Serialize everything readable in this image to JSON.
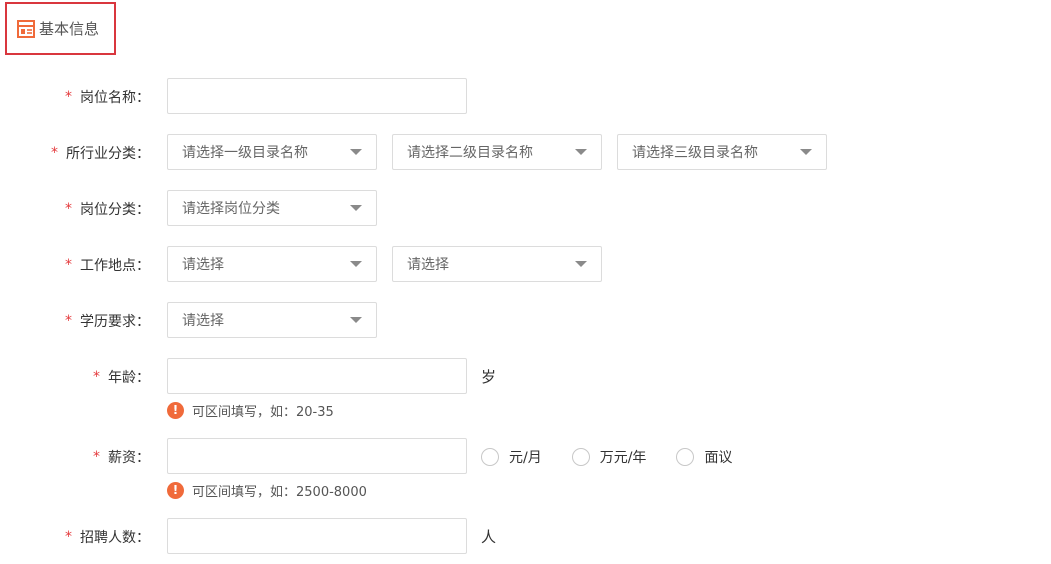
{
  "section": {
    "title": "基本信息",
    "icon": "form-icon"
  },
  "fields": {
    "job_name": {
      "label": "岗位名称：",
      "value": ""
    },
    "industry": {
      "label": "所行业分类：",
      "level1": "请选择一级目录名称",
      "level2": "请选择二级目录名称",
      "level3": "请选择三级目录名称"
    },
    "job_category": {
      "label": "岗位分类：",
      "value": "请选择岗位分类"
    },
    "location": {
      "label": "工作地点：",
      "province": "请选择",
      "city": "请选择"
    },
    "education": {
      "label": "学历要求：",
      "value": "请选择"
    },
    "age": {
      "label": "年龄：",
      "value": "",
      "unit": "岁",
      "hint": "可区间填写，如：20-35"
    },
    "salary": {
      "label": "薪资：",
      "value": "",
      "options": [
        "元/月",
        "万元/年",
        "面议"
      ],
      "hint": "可区间填写，如：2500-8000"
    },
    "headcount": {
      "label": "招聘人数：",
      "value": "",
      "unit": "人"
    }
  },
  "required_mark": "*",
  "hint_mark": "!",
  "colors": {
    "required": "#e4393c",
    "accent": "#f06a3a",
    "header_border": "#d9363e"
  }
}
